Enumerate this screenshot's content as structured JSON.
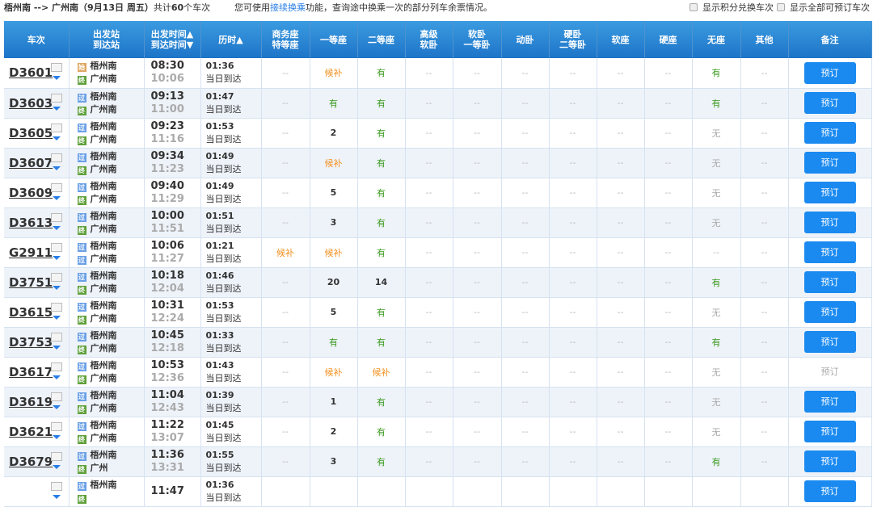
{
  "topbar": {
    "from": "梧州南",
    "arrow": "-->",
    "to": "广州南",
    "date": "（9月13日  周五）",
    "count_prefix": "共计",
    "count": "60",
    "count_suffix": "个车次",
    "tip_prefix": "您可使用",
    "tip_link": "接续换乘",
    "tip_suffix": "功能，查询途中换乘一次的部分列车余票情况。",
    "opt1": "显示积分兑换车次",
    "opt2": "显示全部可预订车次"
  },
  "headers": [
    "车次",
    "出发站\n到达站",
    "出发时间▲\n到达时间▼",
    "历时▲",
    "商务座\n特等座",
    "一等座",
    "二等座",
    "高级\n软卧",
    "软卧\n一等卧",
    "动卧",
    "硬卧\n二等卧",
    "软座",
    "硬座",
    "无座",
    "其他",
    "备注"
  ],
  "book_label": "预订",
  "duration_note": "当日到达",
  "rows": [
    {
      "no": "D3601",
      "from": "梧州南",
      "fb": "始",
      "to": "广州南",
      "tb": "终",
      "dep": "08:30",
      "arr": "10:06",
      "dur": "01:36",
      "seats": [
        "--",
        "候补",
        "有",
        "--",
        "--",
        "--",
        "--",
        "--",
        "--",
        "有",
        "--"
      ],
      "book": true
    },
    {
      "no": "D3603",
      "from": "梧州南",
      "fb": "过",
      "to": "广州南",
      "tb": "终",
      "dep": "09:13",
      "arr": "11:00",
      "dur": "01:47",
      "seats": [
        "--",
        "有",
        "有",
        "--",
        "--",
        "--",
        "--",
        "--",
        "--",
        "有",
        "--"
      ],
      "book": true
    },
    {
      "no": "D3605",
      "from": "梧州南",
      "fb": "过",
      "to": "广州南",
      "tb": "终",
      "dep": "09:23",
      "arr": "11:16",
      "dur": "01:53",
      "seats": [
        "--",
        "2",
        "有",
        "--",
        "--",
        "--",
        "--",
        "--",
        "--",
        "无",
        "--"
      ],
      "book": true
    },
    {
      "no": "D3607",
      "from": "梧州南",
      "fb": "过",
      "to": "广州南",
      "tb": "终",
      "dep": "09:34",
      "arr": "11:23",
      "dur": "01:49",
      "seats": [
        "--",
        "候补",
        "有",
        "--",
        "--",
        "--",
        "--",
        "--",
        "--",
        "无",
        "--"
      ],
      "book": true
    },
    {
      "no": "D3609",
      "from": "梧州南",
      "fb": "过",
      "to": "广州南",
      "tb": "终",
      "dep": "09:40",
      "arr": "11:29",
      "dur": "01:49",
      "seats": [
        "--",
        "5",
        "有",
        "--",
        "--",
        "--",
        "--",
        "--",
        "--",
        "无",
        "--"
      ],
      "book": true
    },
    {
      "no": "D3613",
      "from": "梧州南",
      "fb": "过",
      "to": "广州南",
      "tb": "终",
      "dep": "10:00",
      "arr": "11:51",
      "dur": "01:51",
      "seats": [
        "--",
        "3",
        "有",
        "--",
        "--",
        "--",
        "--",
        "--",
        "--",
        "无",
        "--"
      ],
      "book": true
    },
    {
      "no": "G2911",
      "from": "梧州南",
      "fb": "过",
      "to": "广州南",
      "tb": "过",
      "dep": "10:06",
      "arr": "11:27",
      "dur": "01:21",
      "seats": [
        "候补",
        "候补",
        "有",
        "--",
        "--",
        "--",
        "--",
        "--",
        "--",
        "--",
        "--"
      ],
      "book": true
    },
    {
      "no": "D3751",
      "from": "梧州南",
      "fb": "过",
      "to": "广州南",
      "tb": "终",
      "dep": "10:18",
      "arr": "12:04",
      "dur": "01:46",
      "seats": [
        "--",
        "20",
        "14",
        "--",
        "--",
        "--",
        "--",
        "--",
        "--",
        "有",
        "--"
      ],
      "book": true
    },
    {
      "no": "D3615",
      "from": "梧州南",
      "fb": "过",
      "to": "广州南",
      "tb": "终",
      "dep": "10:31",
      "arr": "12:24",
      "dur": "01:53",
      "seats": [
        "--",
        "5",
        "有",
        "--",
        "--",
        "--",
        "--",
        "--",
        "--",
        "无",
        "--"
      ],
      "book": true
    },
    {
      "no": "D3753",
      "from": "梧州南",
      "fb": "过",
      "to": "广州南",
      "tb": "终",
      "dep": "10:45",
      "arr": "12:18",
      "dur": "01:33",
      "seats": [
        "--",
        "有",
        "有",
        "--",
        "--",
        "--",
        "--",
        "--",
        "--",
        "有",
        "--"
      ],
      "book": true
    },
    {
      "no": "D3617",
      "from": "梧州南",
      "fb": "过",
      "to": "广州南",
      "tb": "终",
      "dep": "10:53",
      "arr": "12:36",
      "dur": "01:43",
      "seats": [
        "--",
        "候补",
        "候补",
        "--",
        "--",
        "--",
        "--",
        "--",
        "--",
        "无",
        "--"
      ],
      "book": false
    },
    {
      "no": "D3619",
      "from": "梧州南",
      "fb": "过",
      "to": "广州南",
      "tb": "终",
      "dep": "11:04",
      "arr": "12:43",
      "dur": "01:39",
      "seats": [
        "--",
        "1",
        "有",
        "--",
        "--",
        "--",
        "--",
        "--",
        "--",
        "无",
        "--"
      ],
      "book": true
    },
    {
      "no": "D3621",
      "from": "梧州南",
      "fb": "过",
      "to": "广州南",
      "tb": "终",
      "dep": "11:22",
      "arr": "13:07",
      "dur": "01:45",
      "seats": [
        "--",
        "2",
        "有",
        "--",
        "--",
        "--",
        "--",
        "--",
        "--",
        "无",
        "--"
      ],
      "book": true
    },
    {
      "no": "D3679",
      "from": "梧州南",
      "fb": "过",
      "to": "广州",
      "tb": "终",
      "dep": "11:36",
      "arr": "13:31",
      "dur": "01:55",
      "seats": [
        "--",
        "3",
        "有",
        "--",
        "--",
        "--",
        "--",
        "--",
        "--",
        "有",
        "--"
      ],
      "book": true
    },
    {
      "no": "",
      "from": "梧州南",
      "fb": "过",
      "to": "",
      "tb": "终",
      "dep": "11:47",
      "arr": "",
      "dur": "01:36",
      "seats": [
        "",
        "",
        "",
        "",
        "",
        "",
        "",
        "",
        "",
        "",
        ""
      ],
      "book": true
    }
  ]
}
